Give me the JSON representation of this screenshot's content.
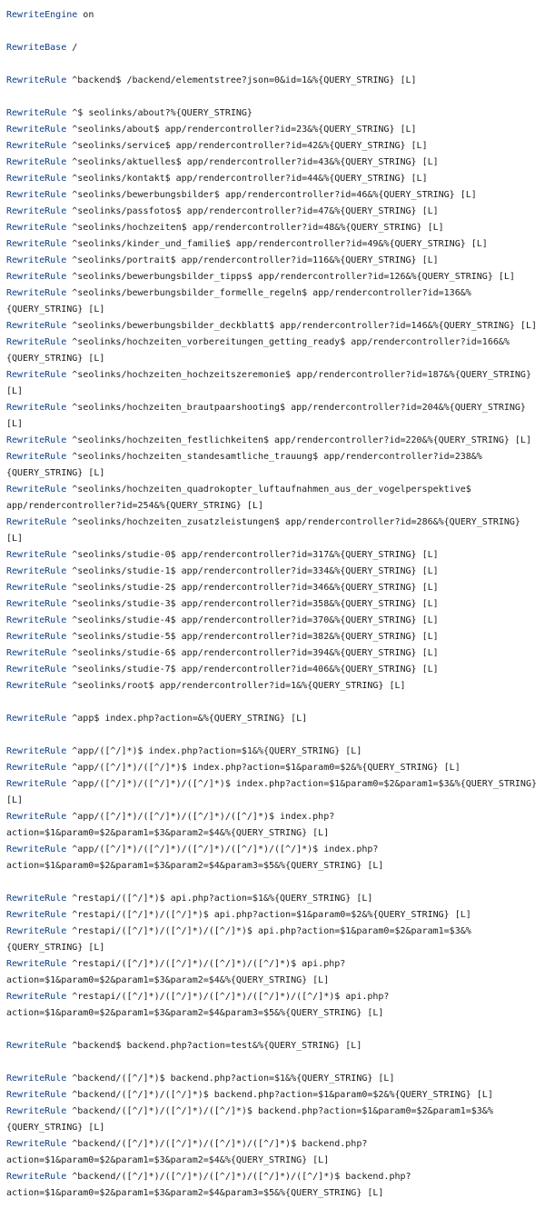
{
  "lines": [
    {
      "d": "RewriteEngine",
      "r": " on"
    },
    {
      "blank": true
    },
    {
      "d": "RewriteBase",
      "r": " /"
    },
    {
      "blank": true
    },
    {
      "d": "RewriteRule",
      "r": " ^backend$ /backend/elementstree?json=0&id=1&%{QUERY_STRING} [L]"
    },
    {
      "blank": true
    },
    {
      "d": "RewriteRule",
      "r": " ^$ seolinks/about?%{QUERY_STRING}"
    },
    {
      "d": "RewriteRule",
      "r": " ^seolinks/about$ app/rendercontroller?id=23&%{QUERY_STRING} [L]"
    },
    {
      "d": "RewriteRule",
      "r": " ^seolinks/service$ app/rendercontroller?id=42&%{QUERY_STRING} [L]"
    },
    {
      "d": "RewriteRule",
      "r": " ^seolinks/aktuelles$ app/rendercontroller?id=43&%{QUERY_STRING} [L]"
    },
    {
      "d": "RewriteRule",
      "r": " ^seolinks/kontakt$ app/rendercontroller?id=44&%{QUERY_STRING} [L]"
    },
    {
      "d": "RewriteRule",
      "r": " ^seolinks/bewerbungsbilder$ app/rendercontroller?id=46&%{QUERY_STRING} [L]"
    },
    {
      "d": "RewriteRule",
      "r": " ^seolinks/passfotos$ app/rendercontroller?id=47&%{QUERY_STRING} [L]"
    },
    {
      "d": "RewriteRule",
      "r": " ^seolinks/hochzeiten$ app/rendercontroller?id=48&%{QUERY_STRING} [L]"
    },
    {
      "d": "RewriteRule",
      "r": " ^seolinks/kinder_und_familie$ app/rendercontroller?id=49&%{QUERY_STRING} [L]"
    },
    {
      "d": "RewriteRule",
      "r": " ^seolinks/portrait$ app/rendercontroller?id=116&%{QUERY_STRING} [L]"
    },
    {
      "d": "RewriteRule",
      "r": " ^seolinks/bewerbungsbilder_tipps$ app/rendercontroller?id=126&%{QUERY_STRING} [L]"
    },
    {
      "d": "RewriteRule",
      "r": " ^seolinks/bewerbungsbilder_formelle_regeln$ app/rendercontroller?id=136&%"
    },
    {
      "d": "",
      "r": "{QUERY_STRING} [L]"
    },
    {
      "d": "RewriteRule",
      "r": " ^seolinks/bewerbungsbilder_deckblatt$ app/rendercontroller?id=146&%{QUERY_STRING} [L]"
    },
    {
      "d": "RewriteRule",
      "r": " ^seolinks/hochzeiten_vorbereitungen_getting_ready$ app/rendercontroller?id=166&%"
    },
    {
      "d": "",
      "r": "{QUERY_STRING} [L]"
    },
    {
      "d": "RewriteRule",
      "r": " ^seolinks/hochzeiten_hochzeitszeremonie$ app/rendercontroller?id=187&%{QUERY_STRING}"
    },
    {
      "d": "",
      "r": "[L]"
    },
    {
      "d": "RewriteRule",
      "r": " ^seolinks/hochzeiten_brautpaarshooting$ app/rendercontroller?id=204&%{QUERY_STRING}"
    },
    {
      "d": "",
      "r": "[L]"
    },
    {
      "d": "RewriteRule",
      "r": " ^seolinks/hochzeiten_festlichkeiten$ app/rendercontroller?id=220&%{QUERY_STRING} [L]"
    },
    {
      "d": "RewriteRule",
      "r": " ^seolinks/hochzeiten_standesamtliche_trauung$ app/rendercontroller?id=238&%"
    },
    {
      "d": "",
      "r": "{QUERY_STRING} [L]"
    },
    {
      "d": "RewriteRule",
      "r": " ^seolinks/hochzeiten_quadrokopter_luftaufnahmen_aus_der_vogelperspektive$"
    },
    {
      "d": "",
      "r": "app/rendercontroller?id=254&%{QUERY_STRING} [L]"
    },
    {
      "d": "RewriteRule",
      "r": " ^seolinks/hochzeiten_zusatzleistungen$ app/rendercontroller?id=286&%{QUERY_STRING}"
    },
    {
      "d": "",
      "r": "[L]"
    },
    {
      "d": "RewriteRule",
      "r": " ^seolinks/studie-0$ app/rendercontroller?id=317&%{QUERY_STRING} [L]"
    },
    {
      "d": "RewriteRule",
      "r": " ^seolinks/studie-1$ app/rendercontroller?id=334&%{QUERY_STRING} [L]"
    },
    {
      "d": "RewriteRule",
      "r": " ^seolinks/studie-2$ app/rendercontroller?id=346&%{QUERY_STRING} [L]"
    },
    {
      "d": "RewriteRule",
      "r": " ^seolinks/studie-3$ app/rendercontroller?id=358&%{QUERY_STRING} [L]"
    },
    {
      "d": "RewriteRule",
      "r": " ^seolinks/studie-4$ app/rendercontroller?id=370&%{QUERY_STRING} [L]"
    },
    {
      "d": "RewriteRule",
      "r": " ^seolinks/studie-5$ app/rendercontroller?id=382&%{QUERY_STRING} [L]"
    },
    {
      "d": "RewriteRule",
      "r": " ^seolinks/studie-6$ app/rendercontroller?id=394&%{QUERY_STRING} [L]"
    },
    {
      "d": "RewriteRule",
      "r": " ^seolinks/studie-7$ app/rendercontroller?id=406&%{QUERY_STRING} [L]"
    },
    {
      "d": "RewriteRule",
      "r": " ^seolinks/root$ app/rendercontroller?id=1&%{QUERY_STRING} [L]"
    },
    {
      "blank": true
    },
    {
      "d": "RewriteRule",
      "r": " ^app$ index.php?action=&%{QUERY_STRING} [L]"
    },
    {
      "blank": true
    },
    {
      "d": "RewriteRule",
      "r": " ^app/([^/]*)$ index.php?action=$1&%{QUERY_STRING} [L]"
    },
    {
      "d": "RewriteRule",
      "r": " ^app/([^/]*)/([^/]*)$ index.php?action=$1&param0=$2&%{QUERY_STRING} [L]"
    },
    {
      "d": "RewriteRule",
      "r": " ^app/([^/]*)/([^/]*)/([^/]*)$ index.php?action=$1&param0=$2&param1=$3&%{QUERY_STRING}"
    },
    {
      "d": "",
      "r": "[L]"
    },
    {
      "d": "RewriteRule",
      "r": " ^app/([^/]*)/([^/]*)/([^/]*)/([^/]*)$ index.php?"
    },
    {
      "d": "",
      "r": "action=$1&param0=$2&param1=$3&param2=$4&%{QUERY_STRING} [L]"
    },
    {
      "d": "RewriteRule",
      "r": " ^app/([^/]*)/([^/]*)/([^/]*)/([^/]*)/([^/]*)$ index.php?"
    },
    {
      "d": "",
      "r": "action=$1&param0=$2&param1=$3&param2=$4&param3=$5&%{QUERY_STRING} [L]"
    },
    {
      "blank": true
    },
    {
      "d": "RewriteRule",
      "r": " ^restapi/([^/]*)$ api.php?action=$1&%{QUERY_STRING} [L]"
    },
    {
      "d": "RewriteRule",
      "r": " ^restapi/([^/]*)/([^/]*)$ api.php?action=$1&param0=$2&%{QUERY_STRING} [L]"
    },
    {
      "d": "RewriteRule",
      "r": " ^restapi/([^/]*)/([^/]*)/([^/]*)$ api.php?action=$1&param0=$2&param1=$3&%"
    },
    {
      "d": "",
      "r": "{QUERY_STRING} [L]"
    },
    {
      "d": "RewriteRule",
      "r": " ^restapi/([^/]*)/([^/]*)/([^/]*)/([^/]*)$ api.php?"
    },
    {
      "d": "",
      "r": "action=$1&param0=$2&param1=$3&param2=$4&%{QUERY_STRING} [L]"
    },
    {
      "d": "RewriteRule",
      "r": " ^restapi/([^/]*)/([^/]*)/([^/]*)/([^/]*)/([^/]*)$ api.php?"
    },
    {
      "d": "",
      "r": "action=$1&param0=$2&param1=$3&param2=$4&param3=$5&%{QUERY_STRING} [L]"
    },
    {
      "blank": true
    },
    {
      "d": "RewriteRule",
      "r": " ^backend$ backend.php?action=test&%{QUERY_STRING} [L]"
    },
    {
      "blank": true
    },
    {
      "d": "RewriteRule",
      "r": " ^backend/([^/]*)$ backend.php?action=$1&%{QUERY_STRING} [L]"
    },
    {
      "d": "RewriteRule",
      "r": " ^backend/([^/]*)/([^/]*)$ backend.php?action=$1&param0=$2&%{QUERY_STRING} [L]"
    },
    {
      "d": "RewriteRule",
      "r": " ^backend/([^/]*)/([^/]*)/([^/]*)$ backend.php?action=$1&param0=$2&param1=$3&%"
    },
    {
      "d": "",
      "r": "{QUERY_STRING} [L]"
    },
    {
      "d": "RewriteRule",
      "r": " ^backend/([^/]*)/([^/]*)/([^/]*)/([^/]*)$ backend.php?"
    },
    {
      "d": "",
      "r": "action=$1&param0=$2&param1=$3&param2=$4&%{QUERY_STRING} [L]"
    },
    {
      "d": "RewriteRule",
      "r": " ^backend/([^/]*)/([^/]*)/([^/]*)/([^/]*)/([^/]*)$ backend.php?"
    },
    {
      "d": "",
      "r": "action=$1&param0=$2&param1=$3&param2=$4&param3=$5&%{QUERY_STRING} [L]"
    }
  ]
}
